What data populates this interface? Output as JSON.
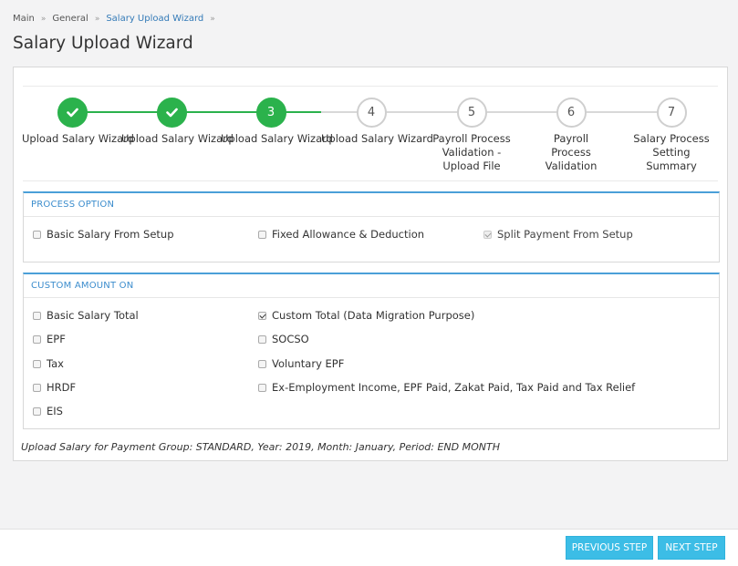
{
  "breadcrumb": {
    "items": [
      "Main",
      "General",
      "Salary Upload Wizard"
    ]
  },
  "page": {
    "title": "Salary Upload Wizard"
  },
  "wizard": {
    "steps": [
      {
        "number": "1",
        "label": "Upload Salary Wizard",
        "state": "done"
      },
      {
        "number": "2",
        "label": "Upload Salary Wizard",
        "state": "done"
      },
      {
        "number": "3",
        "label": "Upload Salary Wizard",
        "state": "current"
      },
      {
        "number": "4",
        "label": "Upload Salary Wizard",
        "state": "todo"
      },
      {
        "number": "5",
        "label": "Payroll Process Validation - Upload File",
        "state": "todo"
      },
      {
        "number": "6",
        "label": "Payroll Process Validation",
        "state": "todo"
      },
      {
        "number": "7",
        "label": "Salary Process Setting Summary",
        "state": "todo"
      }
    ],
    "completed_icon": "check-icon"
  },
  "process_option": {
    "title": "PROCESS OPTION",
    "options": [
      {
        "label": "Basic Salary From Setup",
        "checked": false,
        "disabled": false
      },
      {
        "label": "Fixed Allowance & Deduction",
        "checked": false,
        "disabled": false
      },
      {
        "label": "Split Payment From Setup",
        "checked": true,
        "disabled": true
      }
    ]
  },
  "custom_amount": {
    "title": "CUSTOM AMOUNT ON",
    "options": [
      {
        "label": "Basic Salary Total",
        "checked": false
      },
      {
        "label": "Custom Total (Data Migration Purpose)",
        "checked": true
      },
      {
        "label": "EPF",
        "checked": false
      },
      {
        "label": "SOCSO",
        "checked": false
      },
      {
        "label": "Tax",
        "checked": false
      },
      {
        "label": "Voluntary EPF",
        "checked": false
      },
      {
        "label": "HRDF",
        "checked": false
      },
      {
        "label": "Ex-Employment Income, EPF Paid, Zakat Paid, Tax Paid and Tax Relief",
        "checked": false
      },
      {
        "label": "EIS",
        "checked": false
      }
    ]
  },
  "summary": "Upload Salary for Payment Group: STANDARD, Year: 2019, Month: January, Period: END MONTH",
  "footer": {
    "previous_label": "PREVIOUS STEP",
    "next_label": "NEXT STEP"
  },
  "colors": {
    "accent": "#3cbde6",
    "success": "#2bb24c",
    "section_border": "#4a9fd8",
    "link": "#337ab7"
  }
}
